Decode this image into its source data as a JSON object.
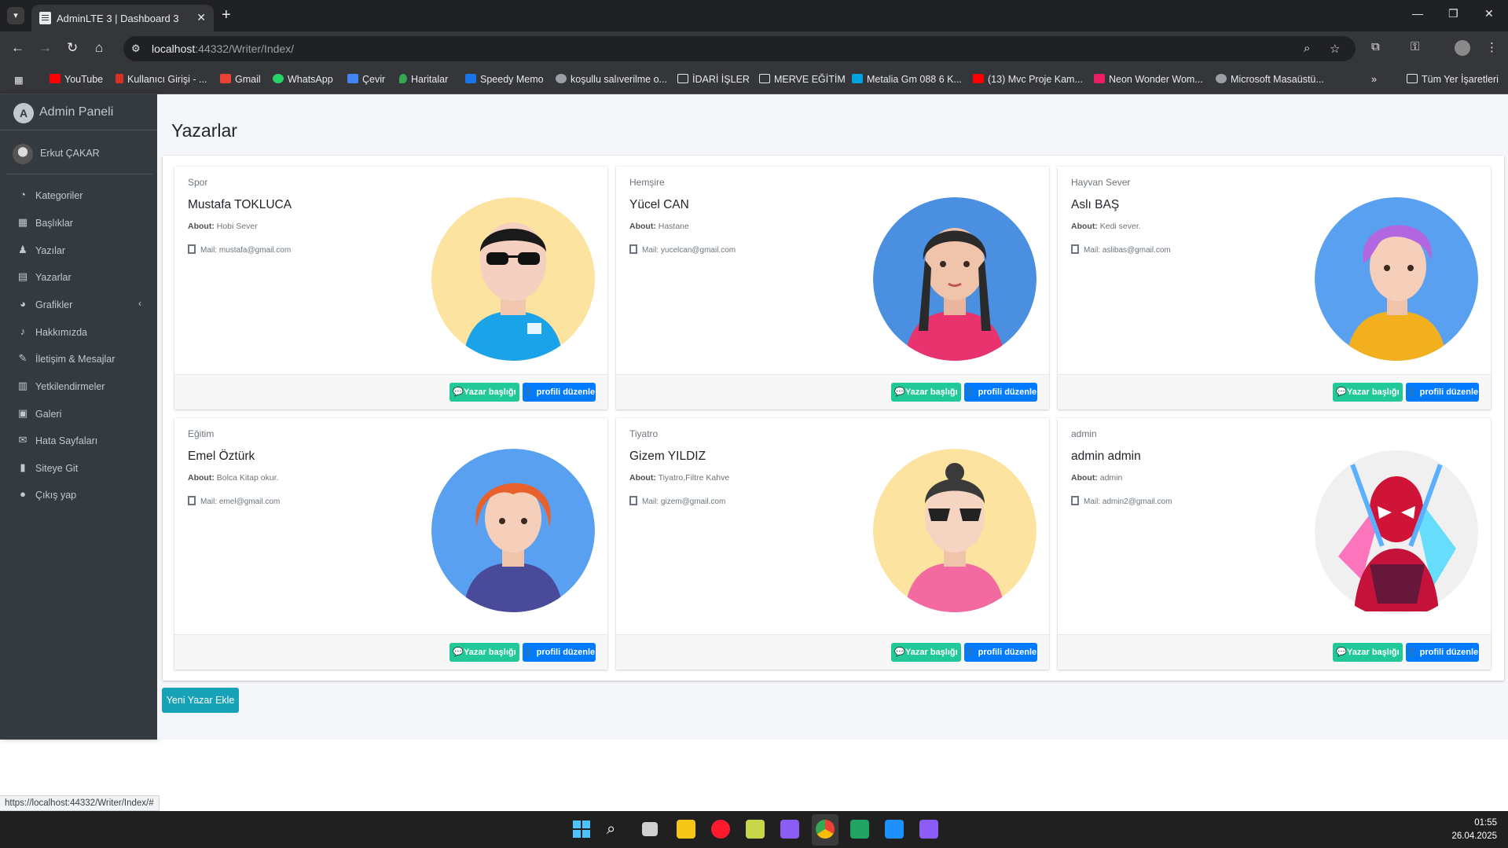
{
  "browser": {
    "tab_title": "AdminLTE 3 | Dashboard 3",
    "url_host": "localhost",
    "url_path": ":44332/Writer/Index/",
    "status_url": "https://localhost:44332/Writer/Index/#",
    "bookmarks": [
      {
        "label": "YouTube",
        "color": "#ff0000"
      },
      {
        "label": "Kullanıcı Girişi - ...",
        "color": "#d93025"
      },
      {
        "label": "Gmail",
        "color": "#ea4335"
      },
      {
        "label": "WhatsApp",
        "color": "#25d366"
      },
      {
        "label": "Çevir",
        "color": "#4285f4"
      },
      {
        "label": "Haritalar",
        "color": "#34a853"
      },
      {
        "label": "Speedy Memo",
        "color": "#1a73e8"
      },
      {
        "label": "koşullu salıverilme o...",
        "color": "#9aa0a6"
      },
      {
        "label": "İDARİ İŞLER",
        "color": "#9aa0a6"
      },
      {
        "label": "MERVE EĞİTİM",
        "color": "#9aa0a6"
      },
      {
        "label": "Metalia Gm 088 6 K...",
        "color": "#00a3e0"
      },
      {
        "label": "(13) Mvc Proje Kam...",
        "color": "#ff0000"
      },
      {
        "label": "Neon Wonder Wom...",
        "color": "#e91e63"
      },
      {
        "label": "Microsoft Masaüstü...",
        "color": "#9aa0a6"
      }
    ],
    "all_bookmarks": "Tüm Yer İşaretleri"
  },
  "sidebar": {
    "brand": "Admin Paneli",
    "user": "Erkut ÇAKAR",
    "items": [
      {
        "label": "Kategoriler",
        "icon": "tachometer-icon"
      },
      {
        "label": "Başlıklar",
        "icon": "th-icon"
      },
      {
        "label": "Yazılar",
        "icon": "user-secret-icon"
      },
      {
        "label": "Yazarlar",
        "icon": "file-icon"
      },
      {
        "label": "Grafikler",
        "icon": "chart-pie-icon"
      },
      {
        "label": "Hakkımızda",
        "icon": "bell-icon"
      },
      {
        "label": "İletişim & Mesajlar",
        "icon": "edit-icon"
      },
      {
        "label": "Yetkilendirmeler",
        "icon": "calendar-icon"
      },
      {
        "label": "Galeri",
        "icon": "image-icon"
      },
      {
        "label": "Hata Sayfaları",
        "icon": "envelope-icon"
      },
      {
        "label": "Siteye Git",
        "icon": "book-icon"
      },
      {
        "label": "Çıkış yap",
        "icon": "apple-icon"
      }
    ]
  },
  "main": {
    "title": "Yazarlar",
    "about_label": "About:",
    "mail_label": "Mail:",
    "btn_titles": "Yazar başlığı",
    "btn_edit": "profili düzenle",
    "add_button": "Yeni Yazar Ekle",
    "writers": [
      {
        "header": "Spor",
        "name": "Mustafa TOKLUCA",
        "about": "Hobi Sever",
        "mail": "mustafa@gmail.com",
        "avatar_bg": "#fde3a0"
      },
      {
        "header": "Hemşire",
        "name": "Yücel CAN",
        "about": "Hastane",
        "mail": "yucelcan@gmail.com",
        "avatar_bg": "#4a8fe0"
      },
      {
        "header": "Hayvan Sever",
        "name": "Aslı BAŞ",
        "about": "Kedi sever.",
        "mail": "aslibas@gmail.com",
        "avatar_bg": "#5aa0f0"
      },
      {
        "header": "Eğitim",
        "name": "Emel Öztürk",
        "about": "Bolca Kitap okur.",
        "mail": "emel@gmail.com",
        "avatar_bg": "#5aa0f0"
      },
      {
        "header": "Tiyatro",
        "name": "Gizem YILDIZ",
        "about": "Tiyatro,Filtre Kahve",
        "mail": "gizem@gmail.com",
        "avatar_bg": "#fde3a0"
      },
      {
        "header": "admin",
        "name": "admin admin",
        "about": "admin",
        "mail": "admin2@gmail.com",
        "avatar_bg": "#f0f0f0"
      }
    ]
  },
  "taskbar": {
    "time": "01:55",
    "date": "26.04.2025"
  }
}
